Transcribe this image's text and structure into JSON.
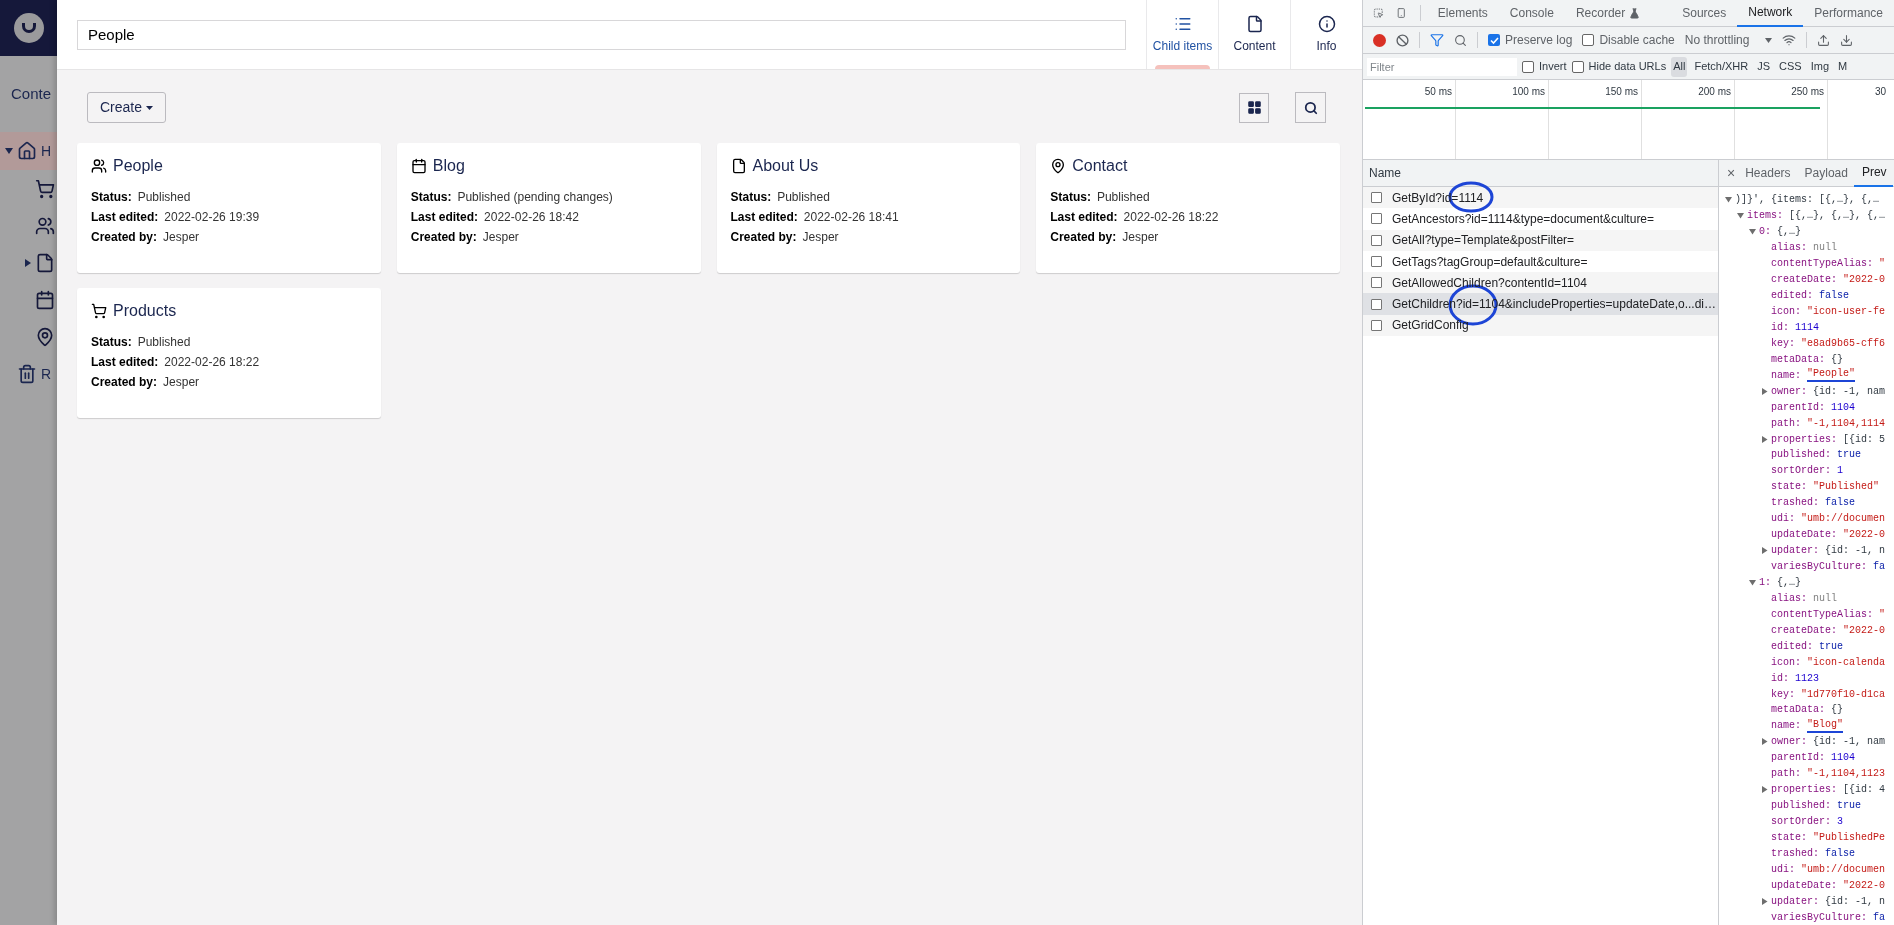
{
  "sidebar": {
    "section_title": "Conte",
    "tree": [
      {
        "label": "H",
        "kind": "home",
        "expanded": true,
        "selected": true,
        "children": [
          {
            "kind": "cart"
          },
          {
            "kind": "people"
          },
          {
            "kind": "document",
            "expanded": false
          },
          {
            "kind": "calendar"
          },
          {
            "kind": "pin"
          }
        ]
      },
      {
        "label": "R",
        "kind": "trash",
        "selected": false
      }
    ]
  },
  "editor": {
    "name_field": {
      "value": "People"
    },
    "apps": [
      {
        "label": "Child items",
        "kind": "list",
        "selected": true
      },
      {
        "label": "Content",
        "kind": "document",
        "selected": false
      },
      {
        "label": "Info",
        "kind": "info",
        "selected": false
      }
    ],
    "create_button": "Create",
    "cards": [
      {
        "kind": "people",
        "title": "People",
        "fields": [
          {
            "label": "Status:",
            "value": "Published"
          },
          {
            "label": "Last edited:",
            "value": "2022-02-26 19:39"
          },
          {
            "label": "Created by:",
            "value": "Jesper"
          }
        ]
      },
      {
        "kind": "calendar",
        "title": "Blog",
        "fields": [
          {
            "label": "Status:",
            "value": "Published (pending changes)"
          },
          {
            "label": "Last edited:",
            "value": "2022-02-26 18:42"
          },
          {
            "label": "Created by:",
            "value": "Jesper"
          }
        ]
      },
      {
        "kind": "document",
        "title": "About Us",
        "fields": [
          {
            "label": "Status:",
            "value": "Published"
          },
          {
            "label": "Last edited:",
            "value": "2022-02-26 18:41"
          },
          {
            "label": "Created by:",
            "value": "Jesper"
          }
        ]
      },
      {
        "kind": "pin",
        "title": "Contact",
        "fields": [
          {
            "label": "Status:",
            "value": "Published"
          },
          {
            "label": "Last edited:",
            "value": "2022-02-26 18:22"
          },
          {
            "label": "Created by:",
            "value": "Jesper"
          }
        ]
      },
      {
        "kind": "cart",
        "title": "Products",
        "fields": [
          {
            "label": "Status:",
            "value": "Published"
          },
          {
            "label": "Last edited:",
            "value": "2022-02-26 18:22"
          },
          {
            "label": "Created by:",
            "value": "Jesper"
          }
        ]
      }
    ]
  },
  "devtools": {
    "tabs": [
      {
        "label": "Elements",
        "kind": "plain",
        "selected": false
      },
      {
        "label": "Console",
        "kind": "plain",
        "selected": false
      },
      {
        "label": "Recorder",
        "kind": "experiment",
        "selected": false
      },
      {
        "label": "Sources",
        "kind": "plain",
        "selected": false
      },
      {
        "label": "Network",
        "kind": "plain",
        "selected": true
      },
      {
        "label": "Performance",
        "kind": "plain",
        "selected": false
      }
    ],
    "toolbar": {
      "recording": true,
      "filter_active": true,
      "checkboxes": [
        {
          "label": "Preserve log",
          "checked": true
        },
        {
          "label": "Disable cache",
          "checked": false
        }
      ],
      "throttling": "No throttling"
    },
    "filter": {
      "placeholder": "Filter",
      "checkboxes": [
        {
          "label": "Invert",
          "checked": false
        },
        {
          "label": "Hide data URLs",
          "checked": false
        }
      ],
      "types": [
        {
          "label": "All",
          "selected": true
        },
        {
          "label": "Fetch/XHR",
          "selected": false
        },
        {
          "label": "JS",
          "selected": false
        },
        {
          "label": "CSS",
          "selected": false
        },
        {
          "label": "Img",
          "selected": false
        },
        {
          "label": "M",
          "selected": false
        }
      ]
    },
    "timeline": {
      "ticks": [
        "50 ms",
        "100 ms",
        "150 ms",
        "200 ms",
        "250 ms",
        "30"
      ]
    },
    "requests": {
      "column": "Name",
      "rows": [
        {
          "name": "GetById?id=1114",
          "checked": false,
          "selected": false,
          "circled": true
        },
        {
          "name": "GetAncestors?id=1114&type=document&culture=",
          "checked": false,
          "selected": false,
          "circled": false
        },
        {
          "name": "GetAll?type=Template&postFilter=",
          "checked": false,
          "selected": false,
          "circled": false
        },
        {
          "name": "GetTags?tagGroup=default&culture=",
          "checked": false,
          "selected": false,
          "circled": false
        },
        {
          "name": "GetAllowedChildren?contentId=1104",
          "checked": false,
          "selected": false,
          "circled": false
        },
        {
          "name": "GetChildren?id=1104&includeProperties=updateDate,o...di…",
          "checked": false,
          "selected": true,
          "circled": true
        },
        {
          "name": "GetGridConfig",
          "checked": false,
          "selected": false,
          "circled": false
        }
      ]
    },
    "detail": {
      "close": "×",
      "tabs": [
        {
          "label": "Headers",
          "selected": false
        },
        {
          "label": "Payload",
          "selected": false
        },
        {
          "label": "Prev",
          "selected": true
        }
      ],
      "preview": [
        {
          "value": ")]}', {items: [{,…}, {,…",
          "kind": "object",
          "expanded": true,
          "children": [
            {
              "key": "items:",
              "value": "[{,…}, {,…}, {,…",
              "kind": "object",
              "expanded": true,
              "children": [
                {
                  "key": "0:",
                  "value": "{,…}",
                  "kind": "object",
                  "expanded": true,
                  "children": [
                    {
                      "key": "alias:",
                      "value": "null",
                      "kind": "null"
                    },
                    {
                      "key": "contentTypeAlias:",
                      "value": "\"",
                      "kind": "string"
                    },
                    {
                      "key": "createDate:",
                      "value": "\"2022-0",
                      "kind": "string"
                    },
                    {
                      "key": "edited:",
                      "value": "false",
                      "kind": "bool"
                    },
                    {
                      "key": "icon:",
                      "value": "\"icon-user-fe",
                      "kind": "string"
                    },
                    {
                      "key": "id:",
                      "value": "1114",
                      "kind": "number"
                    },
                    {
                      "key": "key:",
                      "value": "\"e8ad9b65-cff6",
                      "kind": "string"
                    },
                    {
                      "key": "metaData:",
                      "value": "{}",
                      "kind": "object"
                    },
                    {
                      "key": "name:",
                      "value": "\"People\"",
                      "kind": "string",
                      "underlined": true
                    },
                    {
                      "key": "owner:",
                      "value": "{id: -1, nam",
                      "kind": "object",
                      "expanded": false
                    },
                    {
                      "key": "parentId:",
                      "value": "1104",
                      "kind": "number"
                    },
                    {
                      "key": "path:",
                      "value": "\"-1,1104,1114",
                      "kind": "string"
                    },
                    {
                      "key": "properties:",
                      "value": "[{id: 5",
                      "kind": "object",
                      "expanded": false
                    },
                    {
                      "key": "published:",
                      "value": "true",
                      "kind": "bool"
                    },
                    {
                      "key": "sortOrder:",
                      "value": "1",
                      "kind": "number"
                    },
                    {
                      "key": "state:",
                      "value": "\"Published\"",
                      "kind": "string"
                    },
                    {
                      "key": "trashed:",
                      "value": "false",
                      "kind": "bool"
                    },
                    {
                      "key": "udi:",
                      "value": "\"umb://documen",
                      "kind": "string"
                    },
                    {
                      "key": "updateDate:",
                      "value": "\"2022-0",
                      "kind": "string"
                    },
                    {
                      "key": "updater:",
                      "value": "{id: -1, n",
                      "kind": "object",
                      "expanded": false
                    },
                    {
                      "key": "variesByCulture:",
                      "value": "fa",
                      "kind": "bool"
                    }
                  ]
                },
                {
                  "key": "1:",
                  "value": "{,…}",
                  "kind": "object",
                  "expanded": true,
                  "children": [
                    {
                      "key": "alias:",
                      "value": "null",
                      "kind": "null"
                    },
                    {
                      "key": "contentTypeAlias:",
                      "value": "\"",
                      "kind": "string"
                    },
                    {
                      "key": "createDate:",
                      "value": "\"2022-0",
                      "kind": "string"
                    },
                    {
                      "key": "edited:",
                      "value": "true",
                      "kind": "bool"
                    },
                    {
                      "key": "icon:",
                      "value": "\"icon-calenda",
                      "kind": "string"
                    },
                    {
                      "key": "id:",
                      "value": "1123",
                      "kind": "number"
                    },
                    {
                      "key": "key:",
                      "value": "\"1d770f10-d1ca",
                      "kind": "string"
                    },
                    {
                      "key": "metaData:",
                      "value": "{}",
                      "kind": "object"
                    },
                    {
                      "key": "name:",
                      "value": "\"Blog\"",
                      "kind": "string",
                      "underlined": true
                    },
                    {
                      "key": "owner:",
                      "value": "{id: -1, nam",
                      "kind": "object",
                      "expanded": false
                    },
                    {
                      "key": "parentId:",
                      "value": "1104",
                      "kind": "number"
                    },
                    {
                      "key": "path:",
                      "value": "\"-1,1104,1123",
                      "kind": "string"
                    },
                    {
                      "key": "properties:",
                      "value": "[{id: 4",
                      "kind": "object",
                      "expanded": false
                    },
                    {
                      "key": "published:",
                      "value": "true",
                      "kind": "bool"
                    },
                    {
                      "key": "sortOrder:",
                      "value": "3",
                      "kind": "number"
                    },
                    {
                      "key": "state:",
                      "value": "\"PublishedPe",
                      "kind": "string"
                    },
                    {
                      "key": "trashed:",
                      "value": "false",
                      "kind": "bool"
                    },
                    {
                      "key": "udi:",
                      "value": "\"umb://documen",
                      "kind": "string"
                    },
                    {
                      "key": "updateDate:",
                      "value": "\"2022-0",
                      "kind": "string"
                    },
                    {
                      "key": "updater:",
                      "value": "{id: -1, n",
                      "kind": "object",
                      "expanded": false
                    },
                    {
                      "key": "variesByCulture:",
                      "value": "fa",
                      "kind": "bool"
                    }
                  ]
                }
              ]
            }
          ]
        }
      ]
    }
  }
}
